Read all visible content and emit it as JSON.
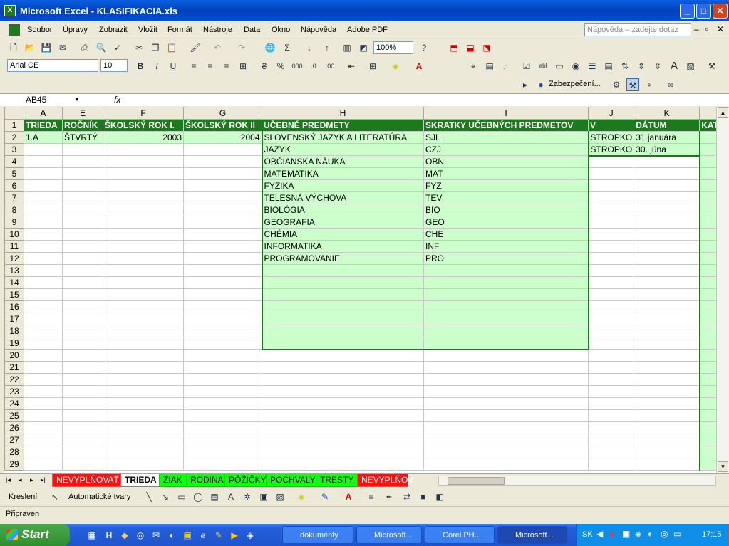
{
  "window": {
    "title": "Microsoft Excel - KLASIFIKACIA.xls",
    "controls": [
      "_",
      "□",
      "✕"
    ]
  },
  "menu": {
    "items": [
      "Soubor",
      "Úpravy",
      "Zobrazit",
      "Vložit",
      "Formát",
      "Nástroje",
      "Data",
      "Okno",
      "Nápověda",
      "Adobe PDF"
    ],
    "help_placeholder": "Nápověda – zadejte dotaz"
  },
  "toolbar": {
    "zoom": "100%",
    "font": "Arial CE",
    "font_size": "10",
    "security_label": "Zabezpečení..."
  },
  "formula": {
    "name_box": "AB45",
    "fx": "fx",
    "content": ""
  },
  "columns": [
    "A",
    "E",
    "F",
    "G",
    "H",
    "I",
    "J",
    "K"
  ],
  "header_row": [
    "TRIEDA",
    "ROČNÍK",
    "ŠKOLSKÝ ROK I.",
    "ŠKOLSKÝ ROK II",
    "UČEBNÉ PREDMETY",
    "SKRATKY UČEBNÝCH PREDMETOV",
    "V",
    "DÁTUM",
    "KAT"
  ],
  "row2": {
    "trieda": "1.A",
    "rocnik": "ŠTVRTÝ",
    "rok1": "2003",
    "rok2": "2004"
  },
  "subjects": [
    {
      "name": "SLOVENSKÝ JAZYK A LITERATÚRA",
      "abbr": "SJL"
    },
    {
      "name": "JAZYK",
      "abbr": "CZJ"
    },
    {
      "name": "OBČIANSKA NÁUKA",
      "abbr": "OBN"
    },
    {
      "name": "MATEMATIKA",
      "abbr": "MAT"
    },
    {
      "name": "FYZIKA",
      "abbr": "FYZ"
    },
    {
      "name": "TELESNÁ VÝCHOVA",
      "abbr": "TEV"
    },
    {
      "name": "BIOLÓGIA",
      "abbr": "BIO"
    },
    {
      "name": "GEOGRAFIA",
      "abbr": "GEO"
    },
    {
      "name": "CHÉMIA",
      "abbr": "CHE"
    },
    {
      "name": "INFORMATIKA",
      "abbr": "INF"
    },
    {
      "name": "PROGRAMOVANIE",
      "abbr": "PRO"
    }
  ],
  "j_values": [
    "STROPKO",
    "STROPKO"
  ],
  "k_values": [
    "31.januára",
    "30. júna"
  ],
  "sheet_tabs": [
    {
      "label": "NEVYPLŇOVAŤ",
      "color": "red"
    },
    {
      "label": "TRIEDA",
      "color": "active"
    },
    {
      "label": "ŽIAK",
      "color": "green"
    },
    {
      "label": "RODINA",
      "color": "green"
    },
    {
      "label": "PÔŽIČKY",
      "color": "green"
    },
    {
      "label": "POCHVALY",
      "color": "green"
    },
    {
      "label": "TRESTY",
      "color": "green"
    },
    {
      "label": "NEVYPLŇOV",
      "color": "red"
    }
  ],
  "drawing": {
    "draw_label": "Kreslení",
    "autoshapes_label": "Automatické tvary"
  },
  "status": {
    "text": "Připraven"
  },
  "taskbar": {
    "start": "Start",
    "tasks": [
      "dokumenty",
      "Microsoft...",
      "Corel PH...",
      "Microsoft..."
    ],
    "lang": "SK",
    "clock": "17:15"
  }
}
